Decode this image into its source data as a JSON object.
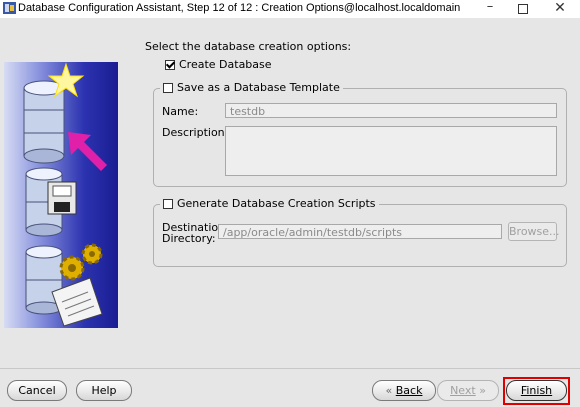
{
  "window": {
    "title": "Database Configuration Assistant, Step 12 of 12 : Creation Options@localhost.localdomain",
    "minimize_glyph": "–",
    "close_glyph": "✕"
  },
  "main": {
    "heading": "Select the database creation options:",
    "create_database": {
      "label": "Create Database",
      "checked": true
    },
    "save_template": {
      "label": "Save as a Database Template",
      "checked": false,
      "name_label": "Name:",
      "name_value": "testdb",
      "description_label": "Description:",
      "description_value": ""
    },
    "generate_scripts": {
      "label": "Generate Database Creation Scripts",
      "checked": false,
      "destination_label_line1": "Destination",
      "destination_label_line2": "Directory:",
      "destination_value": "/app/oracle/admin/testdb/scripts",
      "browse_label": "Browse..."
    }
  },
  "footer": {
    "cancel_label": "Cancel",
    "help_label": "Help",
    "back_arrow": "«",
    "back_label": "Back",
    "next_label": "Next",
    "next_arrow": "»",
    "finish_label": "Finish"
  },
  "colors": {
    "highlight": "#e00000",
    "illustration_blue": "#1a1d92",
    "arrow_magenta": "#e020a8"
  },
  "icons": [
    "database-icon",
    "star-icon",
    "arrow-icon",
    "floppy-disk-icon",
    "gear-icon",
    "scroll-icon"
  ]
}
